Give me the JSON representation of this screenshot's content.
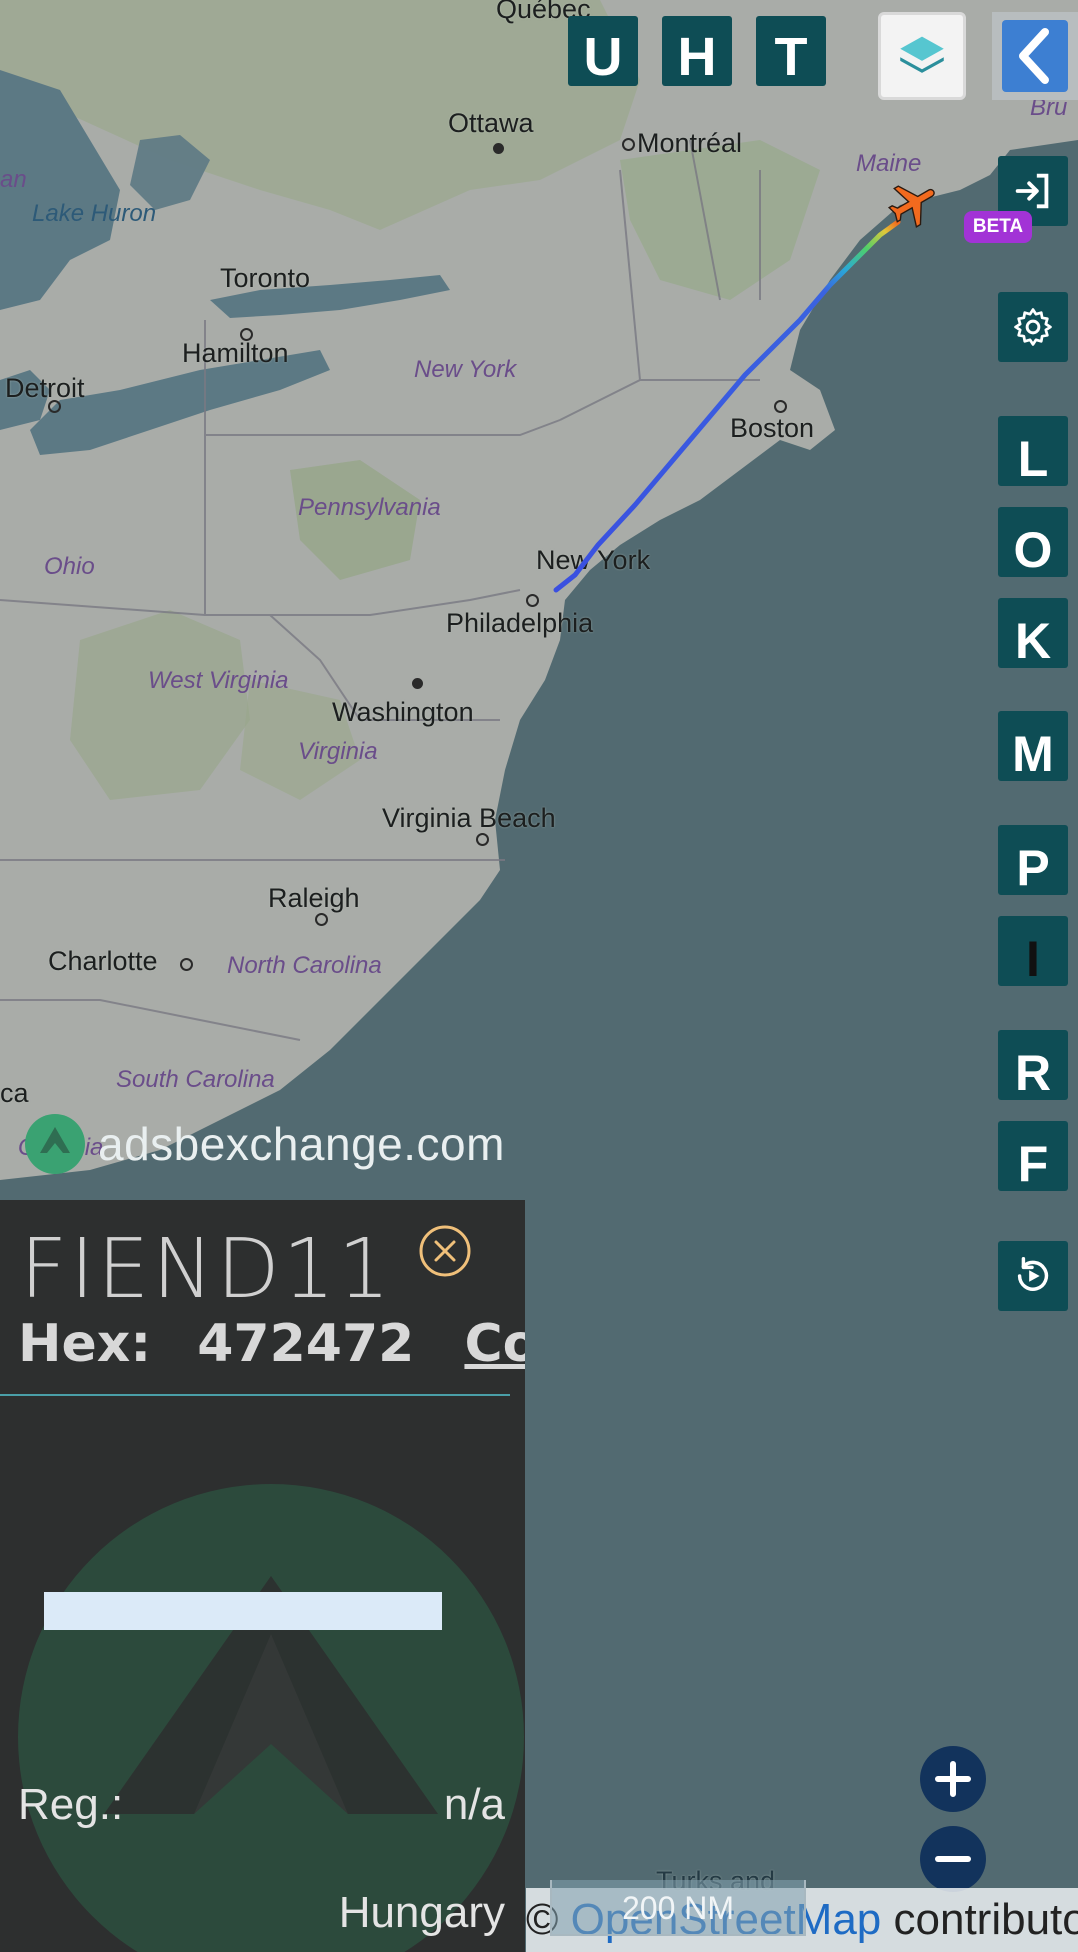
{
  "map": {
    "cities": {
      "quebec": "Québec",
      "ottawa": "Ottawa",
      "montreal": "Montréal",
      "toronto": "Toronto",
      "hamilton": "Hamilton",
      "detroit": "Detroit",
      "boston": "Boston",
      "new_york": "New York",
      "philadelphia": "Philadelphia",
      "washington": "Washington",
      "virginia_beach": "Virginia Beach",
      "raleigh": "Raleigh",
      "charlotte": "Charlotte"
    },
    "states": {
      "maine": "Maine",
      "new_york": "New York",
      "pennsylvania": "Pennsylvania",
      "ohio": "Ohio",
      "west_virginia": "West Virginia",
      "virginia": "Virginia",
      "north_carolina": "North Carolina",
      "south_carolina": "South Carolina",
      "georgia_partial": "Georgia",
      "bru_partial": "Bru",
      "an_partial": "an",
      "ca_partial": "ca"
    },
    "water": {
      "lake_huron": "Lake Huron"
    },
    "partial_labels": {
      "turks": "Turks and"
    }
  },
  "top_buttons": {
    "u": "U",
    "h": "H",
    "t": "T"
  },
  "side_buttons": {
    "l": "L",
    "o": "O",
    "k": "K",
    "m": "M",
    "p": "P",
    "i": "I",
    "r": "R",
    "f": "F"
  },
  "beta_badge": "BETA",
  "watermark": "adsbexchange.com",
  "aircraft_panel": {
    "callsign": "FIEND11",
    "hex_label": "Hex:",
    "hex_value": "472472",
    "copy_label": "Copy",
    "reg_label": "Reg.:",
    "reg_value": "n/a",
    "country": "Hungary"
  },
  "scale_label": "200 NM",
  "attribution": {
    "prefix": "© ",
    "osm": "OpenStreetMap",
    "suffix": " contributors."
  },
  "colors": {
    "button_bg": "#0e4d55",
    "track_main": "#3a63e0",
    "aircraft": "#f26a1e",
    "beta": "#a233d6",
    "zoom_bg": "#12335c"
  },
  "icons": {
    "layers": "layers-icon",
    "back": "chevron-left-icon",
    "login": "login-icon",
    "settings": "gear-icon",
    "replay": "replay-icon",
    "close": "close-circle-icon",
    "zoom_in": "plus-icon",
    "zoom_out": "minus-icon",
    "aircraft": "airplane-icon"
  }
}
